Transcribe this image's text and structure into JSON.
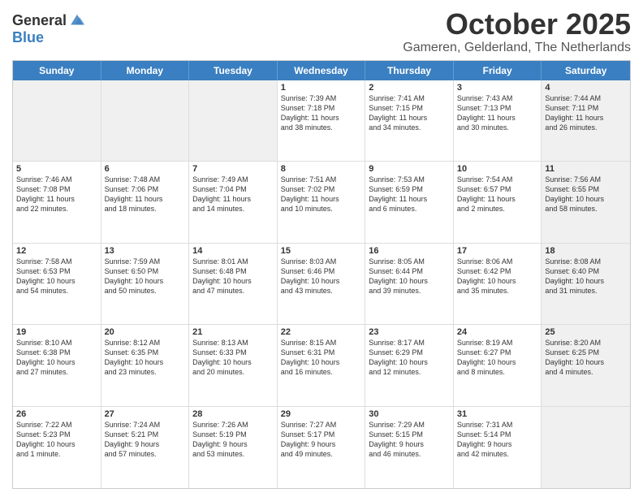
{
  "header": {
    "logo_general": "General",
    "logo_blue": "Blue",
    "month": "October 2025",
    "location": "Gameren, Gelderland, The Netherlands"
  },
  "days_of_week": [
    "Sunday",
    "Monday",
    "Tuesday",
    "Wednesday",
    "Thursday",
    "Friday",
    "Saturday"
  ],
  "weeks": [
    [
      {
        "day": "",
        "text": "",
        "shaded": true
      },
      {
        "day": "",
        "text": "",
        "shaded": true
      },
      {
        "day": "",
        "text": "",
        "shaded": true
      },
      {
        "day": "1",
        "text": "Sunrise: 7:39 AM\nSunset: 7:18 PM\nDaylight: 11 hours\nand 38 minutes."
      },
      {
        "day": "2",
        "text": "Sunrise: 7:41 AM\nSunset: 7:15 PM\nDaylight: 11 hours\nand 34 minutes."
      },
      {
        "day": "3",
        "text": "Sunrise: 7:43 AM\nSunset: 7:13 PM\nDaylight: 11 hours\nand 30 minutes."
      },
      {
        "day": "4",
        "text": "Sunrise: 7:44 AM\nSunset: 7:11 PM\nDaylight: 11 hours\nand 26 minutes.",
        "shaded": true
      }
    ],
    [
      {
        "day": "5",
        "text": "Sunrise: 7:46 AM\nSunset: 7:08 PM\nDaylight: 11 hours\nand 22 minutes."
      },
      {
        "day": "6",
        "text": "Sunrise: 7:48 AM\nSunset: 7:06 PM\nDaylight: 11 hours\nand 18 minutes."
      },
      {
        "day": "7",
        "text": "Sunrise: 7:49 AM\nSunset: 7:04 PM\nDaylight: 11 hours\nand 14 minutes."
      },
      {
        "day": "8",
        "text": "Sunrise: 7:51 AM\nSunset: 7:02 PM\nDaylight: 11 hours\nand 10 minutes."
      },
      {
        "day": "9",
        "text": "Sunrise: 7:53 AM\nSunset: 6:59 PM\nDaylight: 11 hours\nand 6 minutes."
      },
      {
        "day": "10",
        "text": "Sunrise: 7:54 AM\nSunset: 6:57 PM\nDaylight: 11 hours\nand 2 minutes."
      },
      {
        "day": "11",
        "text": "Sunrise: 7:56 AM\nSunset: 6:55 PM\nDaylight: 10 hours\nand 58 minutes.",
        "shaded": true
      }
    ],
    [
      {
        "day": "12",
        "text": "Sunrise: 7:58 AM\nSunset: 6:53 PM\nDaylight: 10 hours\nand 54 minutes."
      },
      {
        "day": "13",
        "text": "Sunrise: 7:59 AM\nSunset: 6:50 PM\nDaylight: 10 hours\nand 50 minutes."
      },
      {
        "day": "14",
        "text": "Sunrise: 8:01 AM\nSunset: 6:48 PM\nDaylight: 10 hours\nand 47 minutes."
      },
      {
        "day": "15",
        "text": "Sunrise: 8:03 AM\nSunset: 6:46 PM\nDaylight: 10 hours\nand 43 minutes."
      },
      {
        "day": "16",
        "text": "Sunrise: 8:05 AM\nSunset: 6:44 PM\nDaylight: 10 hours\nand 39 minutes."
      },
      {
        "day": "17",
        "text": "Sunrise: 8:06 AM\nSunset: 6:42 PM\nDaylight: 10 hours\nand 35 minutes."
      },
      {
        "day": "18",
        "text": "Sunrise: 8:08 AM\nSunset: 6:40 PM\nDaylight: 10 hours\nand 31 minutes.",
        "shaded": true
      }
    ],
    [
      {
        "day": "19",
        "text": "Sunrise: 8:10 AM\nSunset: 6:38 PM\nDaylight: 10 hours\nand 27 minutes."
      },
      {
        "day": "20",
        "text": "Sunrise: 8:12 AM\nSunset: 6:35 PM\nDaylight: 10 hours\nand 23 minutes."
      },
      {
        "day": "21",
        "text": "Sunrise: 8:13 AM\nSunset: 6:33 PM\nDaylight: 10 hours\nand 20 minutes."
      },
      {
        "day": "22",
        "text": "Sunrise: 8:15 AM\nSunset: 6:31 PM\nDaylight: 10 hours\nand 16 minutes."
      },
      {
        "day": "23",
        "text": "Sunrise: 8:17 AM\nSunset: 6:29 PM\nDaylight: 10 hours\nand 12 minutes."
      },
      {
        "day": "24",
        "text": "Sunrise: 8:19 AM\nSunset: 6:27 PM\nDaylight: 10 hours\nand 8 minutes."
      },
      {
        "day": "25",
        "text": "Sunrise: 8:20 AM\nSunset: 6:25 PM\nDaylight: 10 hours\nand 4 minutes.",
        "shaded": true
      }
    ],
    [
      {
        "day": "26",
        "text": "Sunrise: 7:22 AM\nSunset: 5:23 PM\nDaylight: 10 hours\nand 1 minute."
      },
      {
        "day": "27",
        "text": "Sunrise: 7:24 AM\nSunset: 5:21 PM\nDaylight: 9 hours\nand 57 minutes."
      },
      {
        "day": "28",
        "text": "Sunrise: 7:26 AM\nSunset: 5:19 PM\nDaylight: 9 hours\nand 53 minutes."
      },
      {
        "day": "29",
        "text": "Sunrise: 7:27 AM\nSunset: 5:17 PM\nDaylight: 9 hours\nand 49 minutes."
      },
      {
        "day": "30",
        "text": "Sunrise: 7:29 AM\nSunset: 5:15 PM\nDaylight: 9 hours\nand 46 minutes."
      },
      {
        "day": "31",
        "text": "Sunrise: 7:31 AM\nSunset: 5:14 PM\nDaylight: 9 hours\nand 42 minutes."
      },
      {
        "day": "",
        "text": "",
        "shaded": true
      }
    ]
  ]
}
